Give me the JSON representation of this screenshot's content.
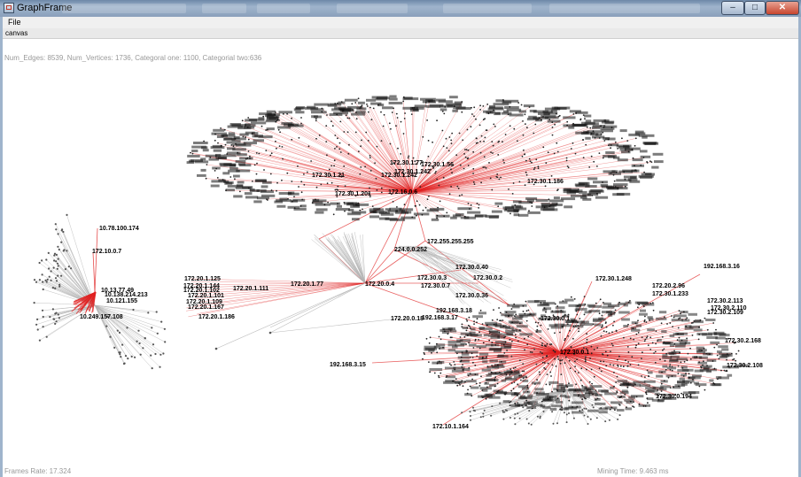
{
  "window": {
    "title": "GraphFrame",
    "minimize": "–",
    "maximize": "□",
    "close": "✕"
  },
  "menu": {
    "file": "File"
  },
  "toolbar": {
    "canvas": "canvas"
  },
  "stats": "Num_Edges: 8539, Num_Vertices: 1736, Categoral one: 1100, Categorial two:636",
  "footer": {
    "frames_rate": "Frames Rate: 17.324",
    "mining_time": "Mining Time: 9.463 ms"
  },
  "colors": {
    "edge_primary": "#e02020",
    "edge_secondary": "#b3b3b3",
    "node": "#555555",
    "label": "#000000",
    "text_muted": "#999999"
  },
  "icons": [
    "app-icon"
  ],
  "graph": {
    "hub_labels": [
      "172.16.0.6",
      "224.0.0.252",
      "172.255.255.255",
      "172.20.0.4",
      "172.20.1.77",
      "172.20.1.111",
      "172.30.0.1",
      "172.30.1.248",
      "192.168.3.16",
      "192.168.3.15",
      "172.10.1.164",
      "192.168.3.18",
      "172.20.0.18",
      "172.30.0.3",
      "10.78.100.174",
      "172.10.0.7",
      "10.13.77.49",
      "10.138.214.213",
      "10.121.155",
      "10.249.157.108"
    ],
    "cluster_labels": [
      "172.30.1.77",
      "172.30.1.56",
      "172.30.1.242",
      "172.30.1.201",
      "172.30.1.186",
      "172.30.1.21",
      "172.20.1.125",
      "172.20.1.144",
      "172.20.1.102",
      "172.20.1.101",
      "172.20.1.109",
      "172.20.1.167",
      "172.20.1.186",
      "172.20.2.96",
      "172.30.2.113",
      "172.30.2.109",
      "172.30.0.40",
      "172.30.0.2",
      "172.30.0.7",
      "172.30.0.36",
      "192.168.3.17",
      "172.30.0.1",
      "172.30.2.168",
      "172.30.2.108",
      "172.30.0.194",
      "172.30.1.233",
      "172.30.2.110",
      "172.30.1.242"
    ]
  }
}
